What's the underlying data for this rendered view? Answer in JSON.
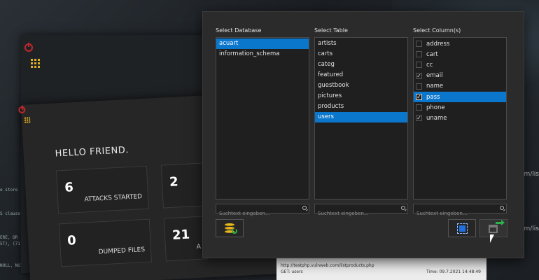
{
  "background": {
    "greeting": "HELLO FRIEND.",
    "stats": [
      {
        "value": "6",
        "label": "ATTACKS STARTED"
      },
      {
        "value": "2",
        "label": ""
      },
      {
        "value": "0",
        "label": "DUMPED FILES"
      },
      {
        "value": "21",
        "label": "A"
      }
    ],
    "url_text": "http://testphp.vulnweb.com/listproducts.php",
    "url_sub": "GET: users",
    "time_text": "Time: 09.7.2021 14:48:49",
    "side_snippets": [
      "m/lis",
      "m/lis"
    ],
    "console_lines": [
      "e store",
      "S clause",
      "ERE, OR",
      "5T), (71",
      "NULL, NUI"
    ]
  },
  "dialog": {
    "databases": {
      "title": "Select Database",
      "items": [
        "acuart",
        "information_schema"
      ],
      "selected_index": 0,
      "search_placeholder": "Suchtext eingeben..."
    },
    "tables": {
      "title": "Select Table",
      "items": [
        "artists",
        "carts",
        "categ",
        "featured",
        "guestbook",
        "pictures",
        "products",
        "users"
      ],
      "selected_index": 7,
      "search_placeholder": "Suchtext eingeben..."
    },
    "columns": {
      "title": "Select Column(s)",
      "items": [
        {
          "label": "address",
          "checked": false
        },
        {
          "label": "cart",
          "checked": false
        },
        {
          "label": "cc",
          "checked": false
        },
        {
          "label": "email",
          "checked": true
        },
        {
          "label": "name",
          "checked": false
        },
        {
          "label": "pass",
          "checked": true
        },
        {
          "label": "phone",
          "checked": false
        },
        {
          "label": "uname",
          "checked": true
        }
      ],
      "selected_index": 5,
      "search_placeholder": "Suchtext eingeben..."
    }
  }
}
